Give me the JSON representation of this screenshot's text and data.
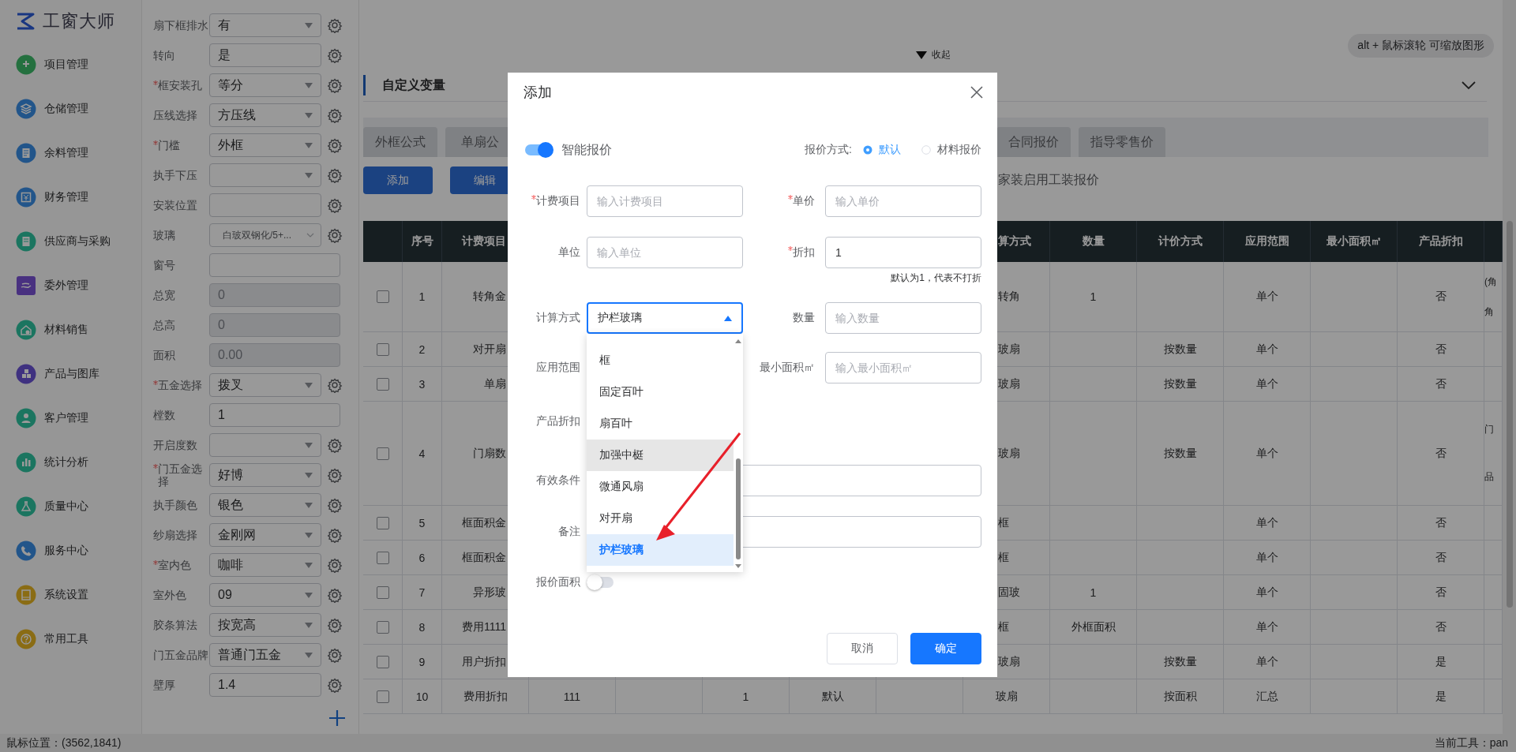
{
  "logo": {
    "text": "工窗大师"
  },
  "sidebar": {
    "items": [
      {
        "label": "项目管理",
        "kind": "puzzle"
      },
      {
        "label": "仓储管理",
        "kind": "layers"
      },
      {
        "label": "余料管理",
        "kind": "document"
      },
      {
        "label": "财务管理",
        "kind": "wallet"
      },
      {
        "label": "供应商与采购",
        "kind": "list"
      },
      {
        "label": "委外管理",
        "kind": "hand"
      },
      {
        "label": "材料销售",
        "kind": "house"
      },
      {
        "label": "产品与图库",
        "kind": "boxes"
      },
      {
        "label": "客户管理",
        "kind": "person"
      },
      {
        "label": "统计分析",
        "kind": "chart"
      },
      {
        "label": "质量中心",
        "kind": "flask"
      },
      {
        "label": "服务中心",
        "kind": "phone"
      },
      {
        "label": "系统设置",
        "kind": "book"
      },
      {
        "label": "常用工具",
        "kind": "question"
      }
    ]
  },
  "form": {
    "rows": [
      {
        "label": "扇下框排水",
        "required": false,
        "kind": "select",
        "value": "有",
        "disabled": false,
        "gear": true
      },
      {
        "label": "转向",
        "required": false,
        "kind": "input",
        "value": "是",
        "disabled": false,
        "gear": true
      },
      {
        "label": "框安装孔",
        "required": true,
        "kind": "select",
        "value": "等分",
        "disabled": false,
        "gear": true
      },
      {
        "label": "压线选择",
        "required": false,
        "kind": "select",
        "value": "方压线",
        "disabled": false,
        "gear": true
      },
      {
        "label": "门槛",
        "required": true,
        "kind": "select",
        "value": "外框",
        "disabled": false,
        "gear": true
      },
      {
        "label": "执手下压",
        "required": false,
        "kind": "select",
        "disabled": false,
        "gear": true
      },
      {
        "label": "安装位置",
        "required": false,
        "kind": "input",
        "disabled": false,
        "gear": true
      },
      {
        "label": "玻璃",
        "required": false,
        "kind": "picker",
        "value": "白玻双钢化/5+...",
        "disabled": false,
        "gear": true
      },
      {
        "label": "窗号",
        "required": false,
        "kind": "input",
        "disabled": false,
        "gear": false
      },
      {
        "label": "总宽",
        "required": false,
        "kind": "input",
        "value": "0",
        "disabled": true,
        "gear": false
      },
      {
        "label": "总高",
        "required": false,
        "kind": "input",
        "value": "0",
        "disabled": true,
        "gear": false
      },
      {
        "label": "面积",
        "required": false,
        "kind": "input",
        "value": "0.00",
        "disabled": true,
        "gear": false
      },
      {
        "label": "五金选择",
        "required": true,
        "kind": "select",
        "value": "拨叉",
        "disabled": false,
        "gear": true
      },
      {
        "label": "樘数",
        "required": false,
        "kind": "input",
        "value": "1",
        "disabled": false,
        "gear": false
      },
      {
        "label": "开启度数",
        "required": false,
        "kind": "select",
        "disabled": false,
        "gear": true
      },
      {
        "label": "门五金选择",
        "required": true,
        "kind": "select",
        "value": "好博",
        "disabled": false,
        "gear": true
      },
      {
        "label": "执手颜色",
        "required": false,
        "kind": "select",
        "value": "银色",
        "disabled": false,
        "gear": true
      },
      {
        "label": "纱扇选择",
        "required": false,
        "kind": "select",
        "value": "金刚网",
        "disabled": false,
        "gear": true
      },
      {
        "label": "室内色",
        "required": true,
        "kind": "select",
        "value": "咖啡",
        "disabled": false,
        "gear": true
      },
      {
        "label": "室外色",
        "required": false,
        "kind": "select",
        "value": "09",
        "disabled": false,
        "gear": true
      },
      {
        "label": "胶条算法",
        "required": false,
        "kind": "select",
        "value": "按宽高",
        "disabled": false,
        "gear": true
      },
      {
        "label": "门五金品牌",
        "required": false,
        "kind": "select",
        "value": "普通门五金",
        "disabled": false,
        "gear": true
      },
      {
        "label": "壁厚",
        "required": false,
        "kind": "input",
        "value": "1.4",
        "disabled": false,
        "gear": true
      }
    ]
  },
  "canvas": {
    "collapse_label": "收起",
    "zoom_hint": "alt + 鼠标滚轮 可缩放图形"
  },
  "section": {
    "title": "自定义变量"
  },
  "tabs": [
    {
      "label": "外框公式",
      "selected": false
    },
    {
      "label": "单扇公",
      "selected": false
    },
    {
      "label": "合同报价",
      "selected": false
    },
    {
      "label": "指导零售价",
      "selected": false
    }
  ],
  "toolbar": {
    "buttons": [
      "添加",
      "编辑"
    ],
    "note": "家装启用工装报价"
  },
  "table": {
    "columns": [
      "序号",
      "计费项目",
      null,
      null,
      null,
      null,
      null,
      "算方式",
      "数量",
      "计价方式",
      "应用范围",
      "最小面积㎡",
      "产品折扣",
      null
    ],
    "rows": [
      {
        "checked": false,
        "cells": [
          "1",
          "转角金",
          null,
          null,
          null,
          null,
          null,
          "转角",
          "1",
          null,
          "单个",
          null,
          "否",
          [
            "(角",
            "角"
          ]
        ]
      },
      {
        "checked": false,
        "cells": [
          "2",
          "对开扇",
          null,
          null,
          null,
          null,
          null,
          "玻扇",
          null,
          "按数量",
          "单个",
          null,
          "否",
          null
        ]
      },
      {
        "checked": false,
        "cells": [
          "3",
          "单扇",
          null,
          null,
          null,
          null,
          null,
          "玻扇",
          null,
          "按数量",
          "单个",
          null,
          "否",
          null
        ]
      },
      {
        "checked": false,
        "cells": [
          "4",
          "门扇数",
          null,
          null,
          null,
          null,
          null,
          "玻扇",
          null,
          "按数量",
          "单个",
          null,
          "否",
          [
            "门",
            "品"
          ]
        ]
      },
      {
        "checked": false,
        "cells": [
          "5",
          "框面积金",
          null,
          null,
          null,
          null,
          null,
          "框",
          null,
          null,
          "单个",
          null,
          "否",
          null
        ]
      },
      {
        "checked": false,
        "cells": [
          "6",
          "框面积金",
          null,
          null,
          null,
          null,
          null,
          "框",
          null,
          null,
          "单个",
          null,
          "否",
          null
        ]
      },
      {
        "checked": false,
        "cells": [
          "7",
          "异形玻",
          null,
          null,
          null,
          null,
          null,
          "固玻",
          "1",
          null,
          "单个",
          null,
          "否",
          null
        ]
      },
      {
        "checked": false,
        "cells": [
          "8",
          "费用1111",
          null,
          null,
          null,
          null,
          null,
          "框",
          "外框面积",
          null,
          "单个",
          null,
          "否",
          null
        ]
      },
      {
        "checked": false,
        "cells": [
          "9",
          "用户折扣",
          null,
          null,
          null,
          null,
          null,
          "玻扇",
          null,
          "按数量",
          "单个",
          null,
          "是",
          null
        ]
      },
      {
        "checked": false,
        "cells": [
          "10",
          "费用折扣",
          "111",
          null,
          "1",
          "默认",
          null,
          "玻扇",
          null,
          "按面积",
          "汇总",
          null,
          "是",
          null
        ]
      }
    ]
  },
  "dialog": {
    "title": "添加",
    "smart_quote": {
      "label": "智能报价",
      "on": true
    },
    "quote_mode": {
      "label": "报价方式:",
      "options": [
        {
          "label": "默认",
          "selected": true
        },
        {
          "label": "材料报价",
          "selected": false
        }
      ]
    },
    "rows": [
      [
        {
          "label": "计费项目",
          "required": true,
          "kind": "input",
          "placeholder": "输入计费项目"
        },
        {
          "label": "单价",
          "required": true,
          "kind": "input",
          "placeholder": "输入单价"
        }
      ],
      [
        {
          "label": "单位",
          "required": false,
          "kind": "input",
          "placeholder": "输入单位"
        },
        {
          "label": "折扣",
          "required": true,
          "kind": "input",
          "value": "1",
          "hint": "默认为1，代表不打折"
        }
      ],
      [
        {
          "label": "计算方式",
          "required": false,
          "kind": "select",
          "value": "护栏玻璃",
          "expanded": true
        },
        {
          "label": "数量",
          "required": false,
          "kind": "input",
          "placeholder": "输入数量"
        }
      ],
      [
        {
          "label": "应用范围",
          "required": false,
          "kind": "covered"
        },
        {
          "label": "最小面积㎡",
          "required": false,
          "kind": "input",
          "placeholder": "输入最小面积㎡"
        }
      ],
      [
        {
          "label": "产品折扣",
          "required": false,
          "kind": "covered"
        }
      ],
      [
        {
          "label": "有效条件",
          "required": false,
          "kind": "wide"
        }
      ],
      [
        {
          "label": "备注",
          "required": false,
          "kind": "wide"
        }
      ],
      [
        {
          "label": "报价面积",
          "required": false,
          "kind": "toggle",
          "on": false
        }
      ]
    ],
    "dropdown": {
      "items": [
        {
          "label": "框",
          "selected": false,
          "hovered": false
        },
        {
          "label": "固定百叶",
          "selected": false,
          "hovered": false
        },
        {
          "label": "扇百叶",
          "selected": false,
          "hovered": false
        },
        {
          "label": "加强中梃",
          "selected": false,
          "hovered": true
        },
        {
          "label": "微通风扇",
          "selected": false,
          "hovered": false
        },
        {
          "label": "对开扇",
          "selected": false,
          "hovered": false
        },
        {
          "label": "护栏玻璃",
          "selected": true,
          "hovered": false
        }
      ]
    },
    "buttons": [
      {
        "label": "取消",
        "kind": "secondary"
      },
      {
        "label": "确定",
        "kind": "primary"
      }
    ]
  },
  "status_bar": {
    "left": "鼠标位置：(3562,1841)",
    "right": "当前工具：pan"
  }
}
